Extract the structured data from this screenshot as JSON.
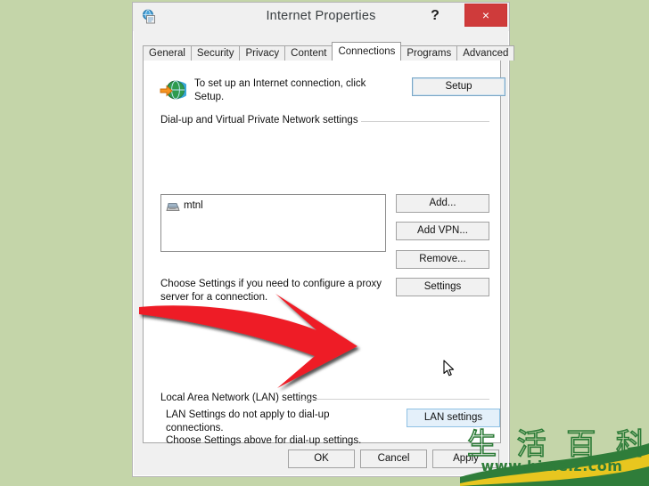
{
  "window": {
    "title": "Internet Properties",
    "icon": "internet-properties-icon",
    "help_label": "?",
    "close_label": "×"
  },
  "tabs": [
    {
      "label": "General",
      "active": false
    },
    {
      "label": "Security",
      "active": false
    },
    {
      "label": "Privacy",
      "active": false
    },
    {
      "label": "Content",
      "active": false
    },
    {
      "label": "Connections",
      "active": true
    },
    {
      "label": "Programs",
      "active": false
    },
    {
      "label": "Advanced",
      "active": false
    }
  ],
  "connections": {
    "intro_text": "To set up an Internet connection, click Setup.",
    "setup_button": "Setup",
    "dialup_group_label": "Dial-up and Virtual Private Network settings",
    "connection_list": [
      {
        "name": "mtnl",
        "icon": "modem-icon"
      }
    ],
    "add_button": "Add...",
    "add_vpn_button": "Add VPN...",
    "remove_button": "Remove...",
    "settings_button": "Settings",
    "proxy_text": "Choose Settings if you need to configure a proxy server for a connection.",
    "lan_group_label": "Local Area Network (LAN) settings",
    "lan_text_line1": "LAN Settings do not apply to dial-up connections.",
    "lan_text_line2": "Choose Settings above for dial-up settings.",
    "lan_settings_button": "LAN settings"
  },
  "footer": {
    "ok_button": "OK",
    "cancel_button": "Cancel",
    "apply_button": "Apply"
  },
  "annotation": {
    "arrow": "red-curved-arrow-pointing-right",
    "arrow_color": "#EE1C25",
    "cursor": "mouse-pointer"
  },
  "watermark": {
    "characters": [
      "生",
      "活",
      "百",
      "科"
    ],
    "url": "www.bimeiz.com"
  },
  "theme": {
    "desktop_background": "#C4D5A9",
    "dialog_background": "#F0F0F0",
    "tabpage_background": "#FFFFFF",
    "close_button_color": "#CF3B3B",
    "hover_button_color": "#E4F0FA",
    "focus_border_color": "#7AA7C7"
  }
}
